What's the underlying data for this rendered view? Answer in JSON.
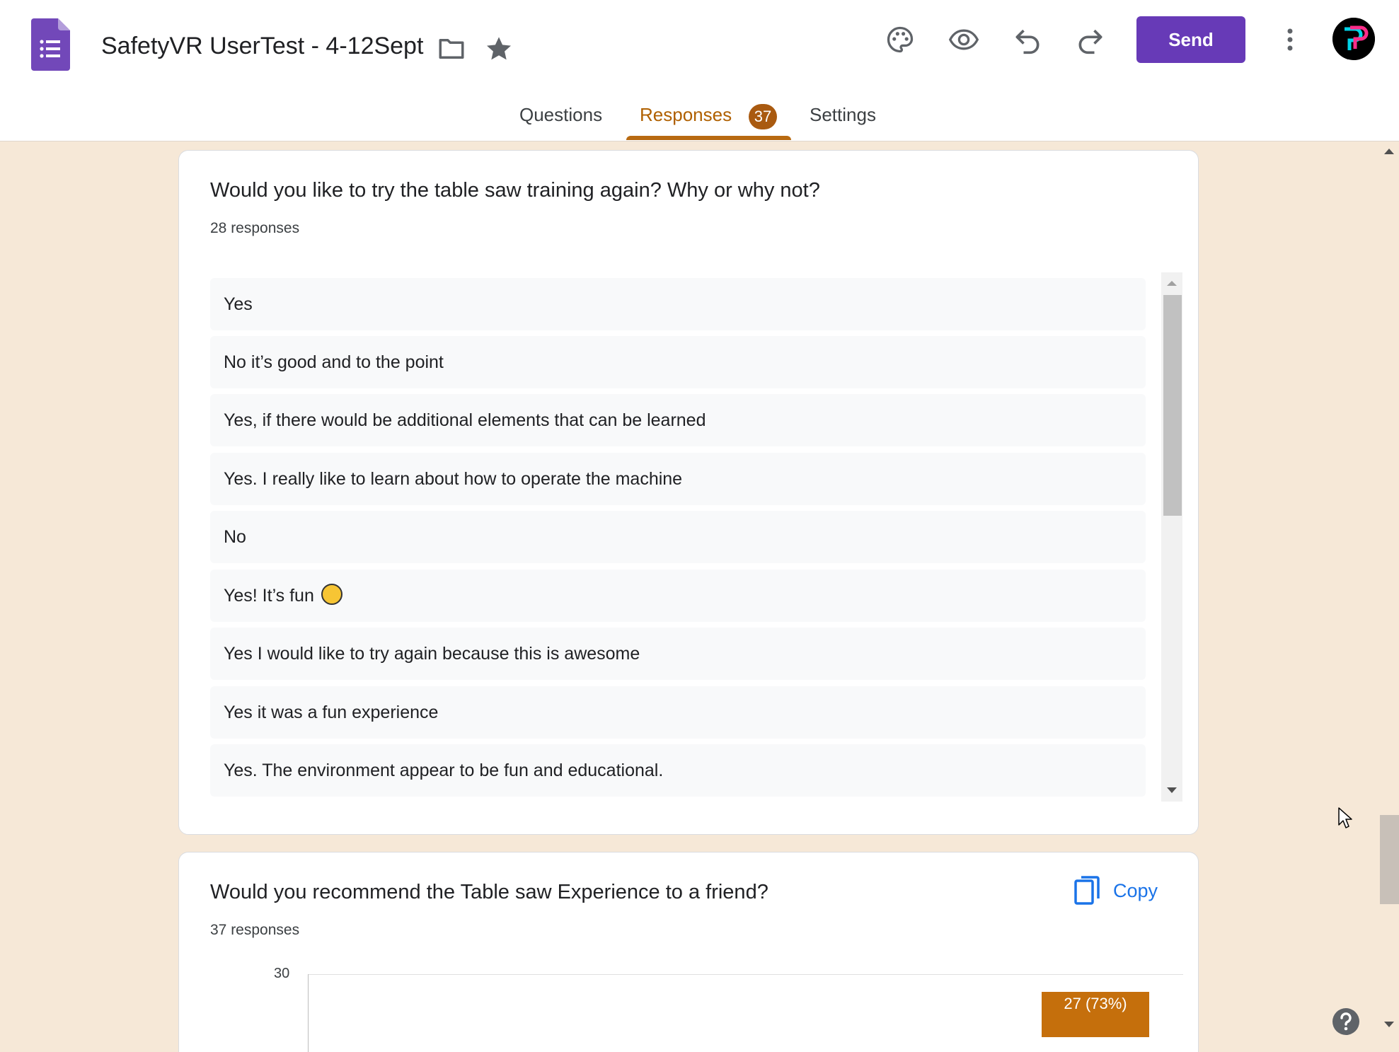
{
  "header": {
    "doc_title": "SafetyVR UserTest - 4-12Sept",
    "send_label": "Send"
  },
  "tabs": [
    {
      "label": "Questions"
    },
    {
      "label": "Responses",
      "badge": "37",
      "active": true
    },
    {
      "label": "Settings"
    }
  ],
  "icons": {
    "app": "google-forms-icon",
    "folder": "folder-icon",
    "star": "star-icon",
    "palette": "palette-icon",
    "preview": "eye-icon",
    "undo": "undo-icon",
    "redo": "redo-icon",
    "more": "more-vert-icon",
    "copy": "copy-icon",
    "help": "help-icon"
  },
  "colors": {
    "accent": "#673ab7",
    "tab_active": "#b06000",
    "background": "#f6e8d7",
    "bar": "#c56f0c"
  },
  "question1": {
    "title": "Would you like to try the table saw training again? Why or why not?",
    "count": "28 responses",
    "responses": [
      "Yes",
      "No it’s good and to the point",
      "Yes, if there would be additional elements that can be learned",
      "Yes. I really like to learn about how to operate the machine",
      "No",
      "Yes! It’s fun",
      "Yes I would like to try again because this is awesome",
      "Yes it was a fun experience",
      "Yes. The environment appear to be fun and educational."
    ]
  },
  "question2": {
    "title": "Would you recommend the Table saw Experience to a friend?",
    "count": "37 responses",
    "copy_label": "Copy"
  },
  "chart_data": {
    "type": "bar",
    "y_ticks": [
      "30"
    ],
    "ylim": [
      0,
      30
    ],
    "bars": [
      {
        "value": 27,
        "label": "27 (73%)"
      }
    ]
  }
}
